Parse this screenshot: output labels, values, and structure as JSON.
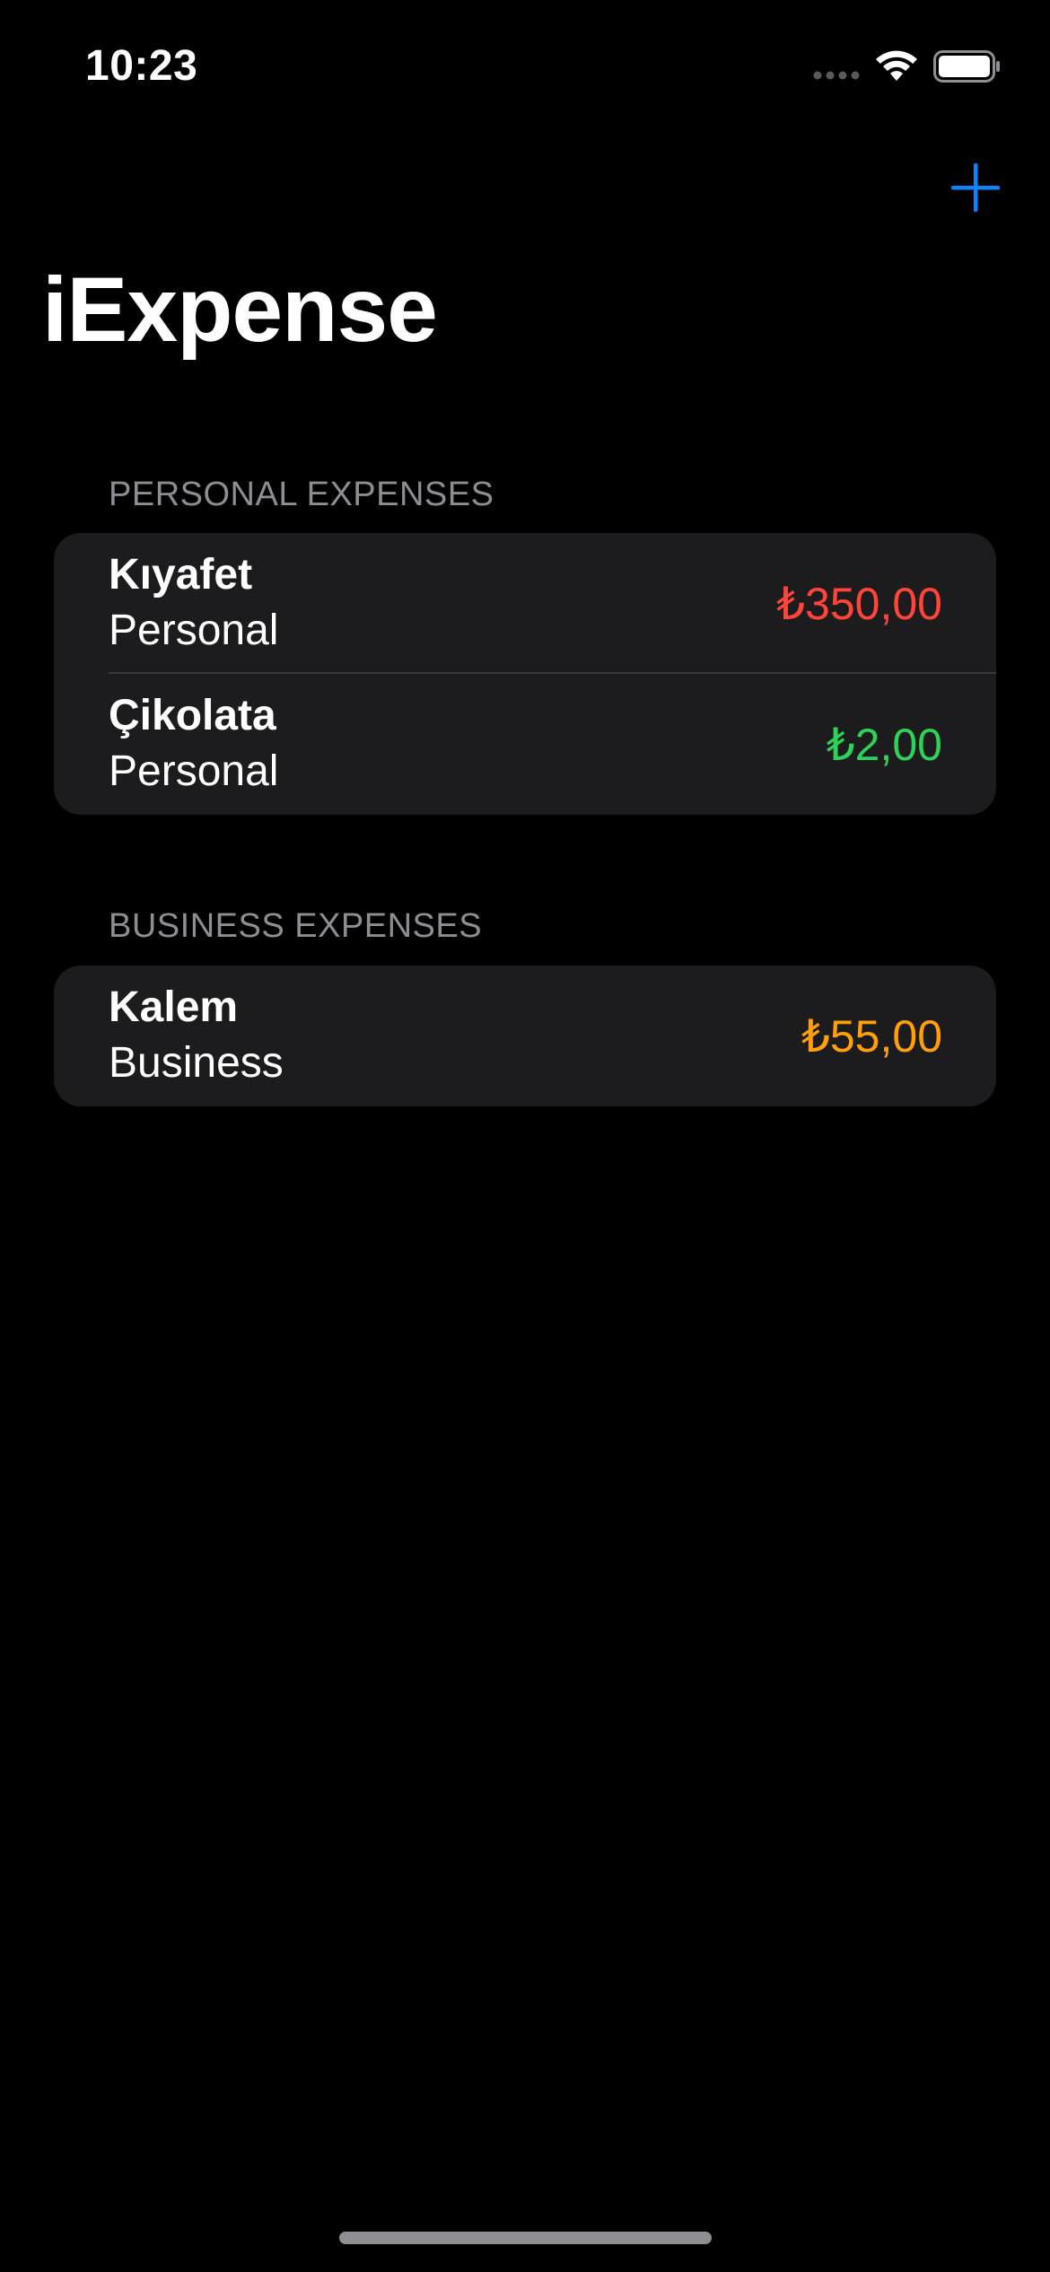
{
  "status_bar": {
    "time": "10:23"
  },
  "nav": {
    "add_icon": "plus-icon",
    "accent_color": "#0a84ff"
  },
  "title": "iExpense",
  "sections": [
    {
      "header": "PERSONAL EXPENSES",
      "items": [
        {
          "name": "Kıyafet",
          "type": "Personal",
          "amount": "₺350,00",
          "amount_color": "#ff453a"
        },
        {
          "name": "Çikolata",
          "type": "Personal",
          "amount": "₺2,00",
          "amount_color": "#30d158"
        }
      ]
    },
    {
      "header": "BUSINESS EXPENSES",
      "items": [
        {
          "name": "Kalem",
          "type": "Business",
          "amount": "₺55,00",
          "amount_color": "#ff9f0a"
        }
      ]
    }
  ]
}
